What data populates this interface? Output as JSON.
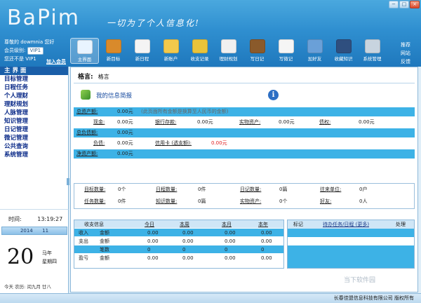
{
  "app": {
    "logo": "BaPim",
    "slogan": "一切为了个人信息化!"
  },
  "window_controls": [
    "−",
    "□",
    "×"
  ],
  "user": {
    "line1": "尊敬的 dowmnia 您好",
    "level_label": "会员级别:",
    "level_value": "VIP1",
    "line3": "您还不是 VIP1",
    "join": "加入会员"
  },
  "toolbar": [
    {
      "label": "主界面",
      "icon": "home-icon",
      "color": "#e9f4ff",
      "active": true
    },
    {
      "label": "新目标",
      "icon": "medal-icon",
      "color": "#d98a2b"
    },
    {
      "label": "新日程",
      "icon": "calendar-icon",
      "color": "#f4f4f4"
    },
    {
      "label": "新账户",
      "icon": "card-icon",
      "color": "#f2c94c"
    },
    {
      "label": "收支记录",
      "icon": "coins-icon",
      "color": "#e9c33a"
    },
    {
      "label": "理财规划",
      "icon": "clipboard-icon",
      "color": "#f0f0f0"
    },
    {
      "label": "写日记",
      "icon": "diary-icon",
      "color": "#8a5a2b"
    },
    {
      "label": "写微记",
      "icon": "note-icon",
      "color": "#f5f5f5"
    },
    {
      "label": "加好友",
      "icon": "contacts-icon",
      "color": "#6aa0d8"
    },
    {
      "label": "收藏知识",
      "icon": "bookshelf-icon",
      "color": "#2f4f7f"
    },
    {
      "label": "系统管理",
      "icon": "gear-icon",
      "color": "#c8d4df"
    }
  ],
  "right_links": [
    "推荐",
    "网站",
    "反馈"
  ],
  "sidebar": {
    "items": [
      {
        "label": "主 界 面",
        "active": true
      },
      {
        "label": "目标管理"
      },
      {
        "label": "日程任务"
      },
      {
        "label": "个人理财"
      },
      {
        "label": "理财规划"
      },
      {
        "label": "人脉管理"
      },
      {
        "label": "知识管理"
      },
      {
        "label": "日记管理"
      },
      {
        "label": "微记管理"
      },
      {
        "label": "公共查询"
      },
      {
        "label": "系统管理"
      }
    ]
  },
  "clock": {
    "time_label": "时间:",
    "time_value": "13:19:27",
    "year": "2014",
    "month": "11",
    "day": "20",
    "zodiac": "马年",
    "weekday": "星期四",
    "lunar": "今天  农历: 闰九月 廿八"
  },
  "main": {
    "motto_label": "格言:",
    "motto_value": "格言",
    "report_title": "我的信息简报",
    "total_assets_label": "总资产额:",
    "total_assets_value": "0.00元",
    "total_assets_note": "(此页面所有金额是换算至人民币的金额)",
    "cash_label": "现金:",
    "cash_value": "0.00元",
    "bank_label": "银行存款:",
    "bank_value": "0.00元",
    "real_label": "实物资产:",
    "real_value": "0.00元",
    "claims_label": "债权:",
    "claims_value": "0.00元",
    "total_debt_label": "总负债额:",
    "total_debt_value": "0.00元",
    "debt_label": "负债:",
    "debt_value": "0.00元",
    "credit_label": "信用卡 (透支额):",
    "credit_value": "0.00元",
    "net_label": "净资产额:",
    "net_value": "0.00元",
    "goal_label": "目标数量:",
    "goal_value": "0个",
    "schedule_label": "日程数量:",
    "schedule_value": "0件",
    "diary_label": "日记数量:",
    "diary_value": "0篇",
    "partner_label": "往来单位:",
    "partner_value": "0户",
    "task_label": "任务数量:",
    "task_value": "0件",
    "knowledge_label": "知识数量:",
    "knowledge_value": "0篇",
    "physical_label": "实物资产:",
    "physical_value": "0个",
    "friend_label": "好友:",
    "friend_value": "0人"
  },
  "income_table": {
    "headers": [
      "收支信息",
      "今日",
      "本周",
      "本月",
      "本年"
    ],
    "rows": [
      {
        "type": "收入",
        "item": "金额",
        "values": [
          "0.00",
          "0.00",
          "0.00",
          "0.00"
        ]
      },
      {
        "type": "支出",
        "item": "金额",
        "values": [
          "0.00",
          "0.00",
          "0.00",
          "0.00"
        ]
      },
      {
        "type": "",
        "item": "笔数",
        "values": [
          "0",
          "0",
          "0",
          "0"
        ]
      },
      {
        "type": "盈亏",
        "item": "金额",
        "values": [
          "0.00",
          "0.00",
          "0.00",
          "0.00"
        ]
      }
    ]
  },
  "todo_table": {
    "headers": [
      "标记",
      "待办任务/日程 (更多)",
      "处理"
    ]
  },
  "statusbar": {
    "company": "长春佳盟信息科技有限公司  版权所有"
  },
  "watermark": "当下软件园"
}
